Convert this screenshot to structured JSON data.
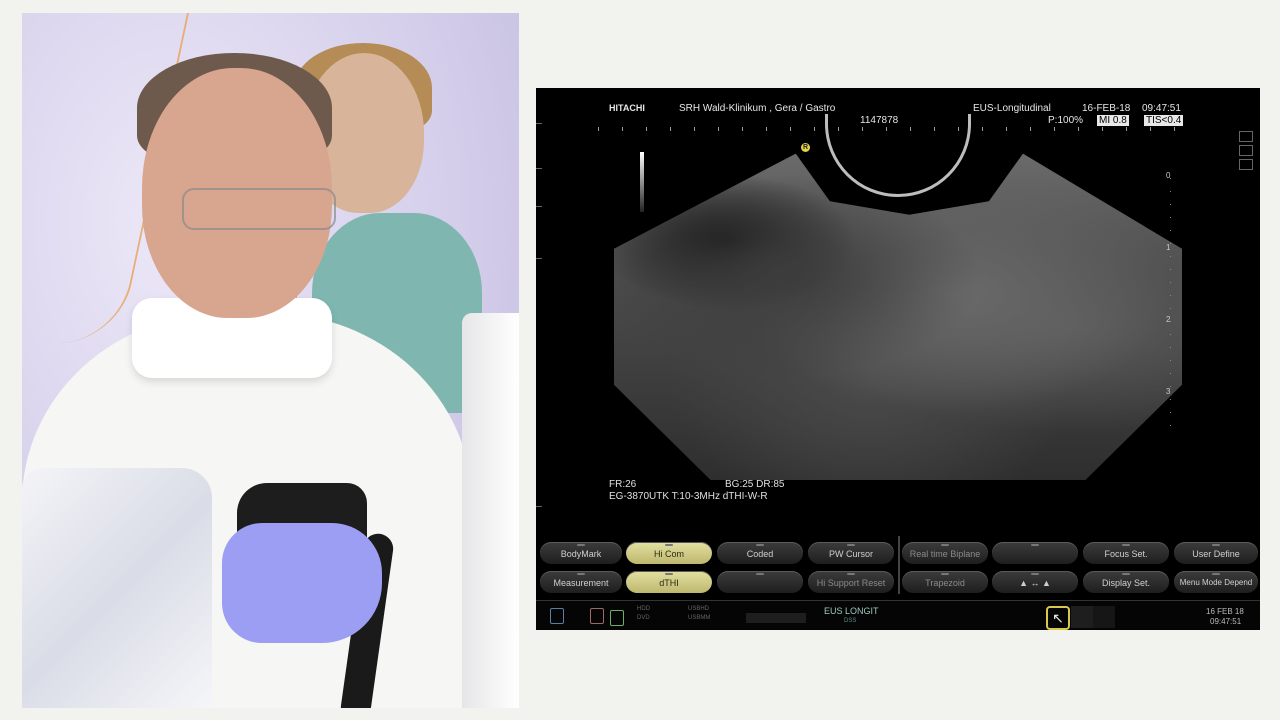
{
  "header": {
    "brand": "HITACHI",
    "site": "SRH Wald-Klinikum , Gera / Gastro",
    "mode": "EUS-Longitudinal",
    "date": "16-FEB-18",
    "time": "09:47:51",
    "patient_id": "1147878",
    "power": "P:100%",
    "mi": "MI 0.8",
    "tis": "TIS<0.4"
  },
  "depth_labels": [
    "0",
    "1",
    "2",
    "3"
  ],
  "probe_marker": "R",
  "info": {
    "line1_left": "FR:26",
    "line1_right": "BG:25  DR:85",
    "line2": "EG-3870UTK  T:10-3MHz   dTHI-W-R"
  },
  "buttons": {
    "row1": [
      "BodyMark",
      "Hi Com",
      "Coded",
      "PW Cursor",
      "Real time Biplane",
      "",
      "Focus Set.",
      "User Define"
    ],
    "row2": [
      "Measurement",
      "dTHI",
      "",
      "Hi Support Reset",
      "Trapezoid",
      "▲ ↔ ▲",
      "Display Set.",
      "Menu Mode Depend"
    ]
  },
  "status": {
    "hdd": "HDD",
    "dvd": "DVD",
    "usbhd": "USBHD",
    "usbmem": "USBMM",
    "mode": "EUS LONGIT",
    "sub": "DSS",
    "pointer_icon": "↖",
    "date": "16 FEB 18",
    "time": "09:47:51"
  }
}
